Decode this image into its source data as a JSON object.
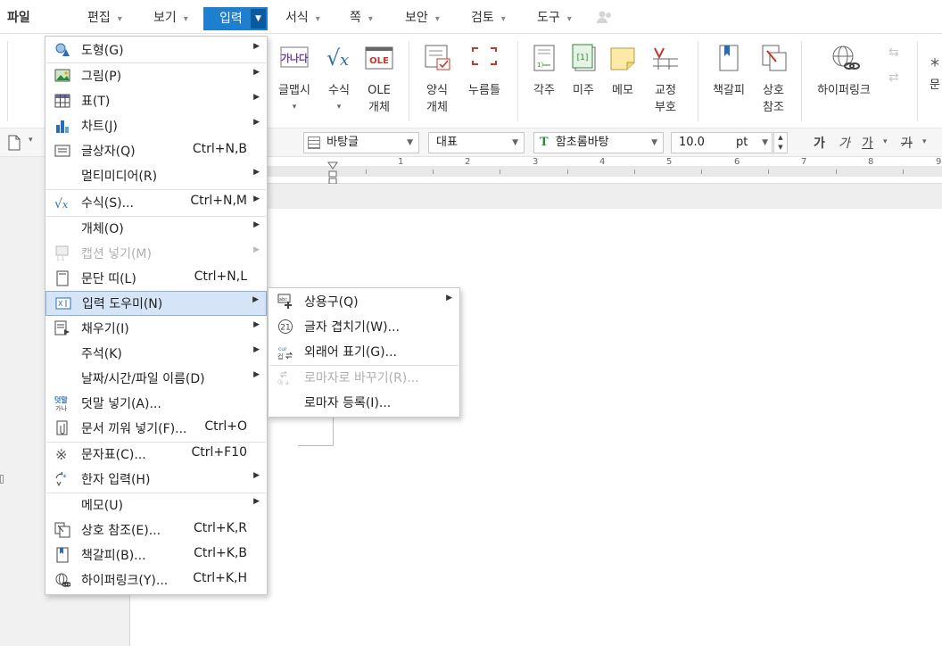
{
  "menubar": {
    "items": [
      {
        "label": "파일"
      },
      {
        "label": "편집"
      },
      {
        "label": "보기"
      },
      {
        "label": "입력"
      },
      {
        "label": "서식"
      },
      {
        "label": "쪽"
      },
      {
        "label": "보안"
      },
      {
        "label": "검토"
      },
      {
        "label": "도구"
      }
    ]
  },
  "ribbon": {
    "buttons": [
      {
        "label": "글맵시",
        "icon": "wordart-icon"
      },
      {
        "label": "수식",
        "icon": "formula-icon"
      },
      {
        "label": "OLE\n개체",
        "icon": "ole-icon"
      },
      {
        "label": "양식\n개체",
        "icon": "form-object-icon"
      },
      {
        "label": "누름틀",
        "icon": "field-icon"
      },
      {
        "label": "각주",
        "icon": "footnote-icon"
      },
      {
        "label": "미주",
        "icon": "endnote-icon"
      },
      {
        "label": "메모",
        "icon": "memo-icon"
      },
      {
        "label": "교정\n부호",
        "icon": "proofreading-icon"
      },
      {
        "label": "책갈피",
        "icon": "bookmark-icon"
      },
      {
        "label": "상호\n참조",
        "icon": "cross-reference-icon"
      },
      {
        "label": "하이퍼링크",
        "icon": "hyperlink-icon"
      },
      {
        "label": "문",
        "icon": "truncated-icon"
      }
    ]
  },
  "format_bar": {
    "style": "바탕글",
    "language": "대표",
    "font": "함초롬바탕",
    "size": "10.0",
    "unit": "pt",
    "bold_glyph": "가",
    "italic_glyph": "가",
    "underline_glyph": "가",
    "strike_glyph": "가"
  },
  "ruler": {
    "numbers": [
      "1",
      "2",
      "3",
      "4",
      "5",
      "6",
      "7",
      "8",
      "9"
    ]
  },
  "input_menu": {
    "items": [
      {
        "label": "도형(G)",
        "shortcut": "",
        "submenu": true,
        "icon": "shape-icon"
      },
      {
        "label": "그림(P)",
        "shortcut": "",
        "submenu": true,
        "icon": "picture-icon"
      },
      {
        "label": "표(T)",
        "shortcut": "",
        "submenu": true,
        "icon": "table-icon"
      },
      {
        "label": "차트(J)",
        "shortcut": "",
        "submenu": true,
        "icon": "chart-icon"
      },
      {
        "label": "글상자(Q)",
        "shortcut": "Ctrl+N,B",
        "submenu": false,
        "icon": "textbox-icon"
      },
      {
        "label": "멀티미디어(R)",
        "shortcut": "",
        "submenu": true,
        "icon": ""
      },
      {
        "label": "수식(S)...",
        "shortcut": "Ctrl+N,M",
        "submenu": true,
        "icon": "formula-icon"
      },
      {
        "label": "개체(O)",
        "shortcut": "",
        "submenu": true,
        "icon": ""
      },
      {
        "label": "캡션 넣기(M)",
        "shortcut": "",
        "submenu": true,
        "icon": "caption-icon",
        "disabled": true
      },
      {
        "label": "문단 띠(L)",
        "shortcut": "Ctrl+N,L",
        "submenu": false,
        "icon": "paragraph-band-icon"
      },
      {
        "label": "입력 도우미(N)",
        "shortcut": "",
        "submenu": true,
        "icon": "input-helper-icon",
        "highlighted": true
      },
      {
        "label": "채우기(I)",
        "shortcut": "",
        "submenu": true,
        "icon": "fill-icon"
      },
      {
        "label": "주석(K)",
        "shortcut": "",
        "submenu": true,
        "icon": ""
      },
      {
        "label": "날짜/시간/파일 이름(D)",
        "shortcut": "",
        "submenu": true,
        "icon": ""
      },
      {
        "label": "덧말 넣기(A)...",
        "shortcut": "",
        "submenu": false,
        "icon": "ruby-text-icon"
      },
      {
        "label": "문서 끼워 넣기(F)...",
        "shortcut": "Ctrl+O",
        "submenu": false,
        "icon": "insert-document-icon"
      },
      {
        "label": "문자표(C)...",
        "shortcut": "Ctrl+F10",
        "submenu": false,
        "icon": "symbol-icon"
      },
      {
        "label": "한자 입력(H)",
        "shortcut": "",
        "submenu": true,
        "icon": "hanja-icon"
      },
      {
        "label": "메모(U)",
        "shortcut": "",
        "submenu": true,
        "icon": ""
      },
      {
        "label": "상호 참조(E)...",
        "shortcut": "Ctrl+K,R",
        "submenu": false,
        "icon": "cross-reference-icon"
      },
      {
        "label": "책갈피(B)...",
        "shortcut": "Ctrl+K,B",
        "submenu": false,
        "icon": "bookmark-icon"
      },
      {
        "label": "하이퍼링크(Y)...",
        "shortcut": "Ctrl+K,H",
        "submenu": false,
        "icon": "hyperlink-icon"
      }
    ]
  },
  "input_helper_submenu": {
    "items": [
      {
        "label": "상용구(Q)",
        "submenu": true,
        "icon": "autotext-icon"
      },
      {
        "label": "글자 겹치기(W)...",
        "submenu": false,
        "icon": "overlap-char-icon"
      },
      {
        "label": "외래어 표기(G)...",
        "submenu": false,
        "icon": "foreign-word-icon"
      },
      {
        "label": "로마자로 바꾸기(R)...",
        "submenu": false,
        "icon": "romanize-icon",
        "disabled": true
      },
      {
        "label": "로마자 등록(I)...",
        "submenu": false,
        "icon": ""
      }
    ]
  }
}
